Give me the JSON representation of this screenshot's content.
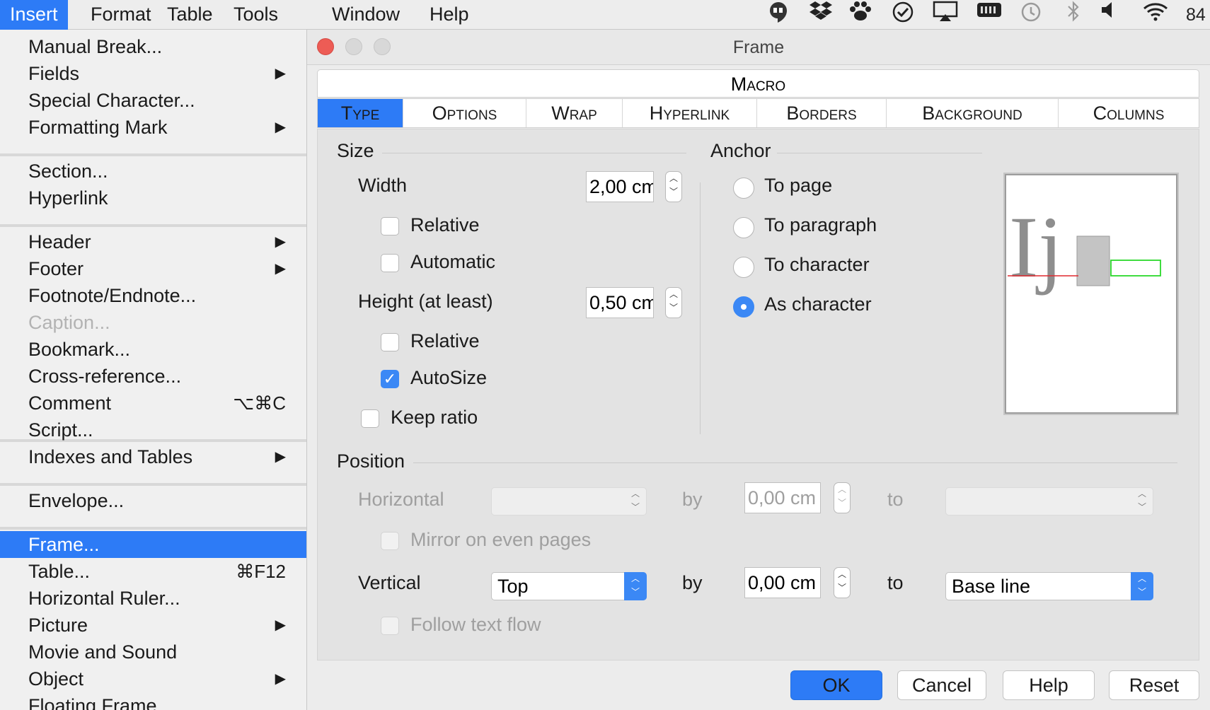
{
  "menubar": {
    "items": [
      "Insert",
      "Format",
      "Table",
      "Tools",
      "Window",
      "Help"
    ],
    "tray": [
      "hangouts-icon",
      "dropbox-icon",
      "paw-icon",
      "checkmark-circle-icon",
      "airplay-icon",
      "battery-meter-icon",
      "time-machine-icon",
      "bluetooth-icon",
      "volume-icon",
      "wifi-icon"
    ],
    "battery_text": "84"
  },
  "menu": {
    "items": [
      {
        "label": "Manual Break...",
        "arrow": false,
        "shortcut": "",
        "state": "normal"
      },
      {
        "label": "Fields",
        "arrow": true,
        "shortcut": "",
        "state": "normal"
      },
      {
        "label": "Special Character...",
        "arrow": false,
        "shortcut": "",
        "state": "normal"
      },
      {
        "label": "Formatting Mark",
        "arrow": true,
        "shortcut": "",
        "state": "normal"
      },
      {
        "label": "Section...",
        "arrow": false,
        "shortcut": "",
        "state": "normal"
      },
      {
        "label": "Hyperlink",
        "arrow": false,
        "shortcut": "",
        "state": "normal"
      },
      {
        "label": "Header",
        "arrow": true,
        "shortcut": "",
        "state": "normal"
      },
      {
        "label": "Footer",
        "arrow": true,
        "shortcut": "",
        "state": "normal"
      },
      {
        "label": "Footnote/Endnote...",
        "arrow": false,
        "shortcut": "",
        "state": "normal"
      },
      {
        "label": "Caption...",
        "arrow": false,
        "shortcut": "",
        "state": "disabled"
      },
      {
        "label": "Bookmark...",
        "arrow": false,
        "shortcut": "",
        "state": "normal"
      },
      {
        "label": "Cross-reference...",
        "arrow": false,
        "shortcut": "",
        "state": "normal"
      },
      {
        "label": "Comment",
        "arrow": false,
        "shortcut": "⌥⌘C",
        "state": "normal"
      },
      {
        "label": "Script...",
        "arrow": false,
        "shortcut": "",
        "state": "normal"
      },
      {
        "label": "Indexes and Tables",
        "arrow": true,
        "shortcut": "",
        "state": "normal"
      },
      {
        "label": "Envelope...",
        "arrow": false,
        "shortcut": "",
        "state": "normal"
      },
      {
        "label": "Frame...",
        "arrow": false,
        "shortcut": "",
        "state": "selected"
      },
      {
        "label": "Table...",
        "arrow": false,
        "shortcut": "⌘F12",
        "state": "normal"
      },
      {
        "label": "Horizontal Ruler...",
        "arrow": false,
        "shortcut": "",
        "state": "normal"
      },
      {
        "label": "Picture",
        "arrow": true,
        "shortcut": "",
        "state": "normal"
      },
      {
        "label": "Movie and Sound",
        "arrow": false,
        "shortcut": "",
        "state": "normal"
      },
      {
        "label": "Object",
        "arrow": true,
        "shortcut": "",
        "state": "normal"
      },
      {
        "label": "Floating Frame...",
        "arrow": false,
        "shortcut": "",
        "state": "normal"
      }
    ]
  },
  "dialog": {
    "title": "Frame",
    "top_tab": "Macro",
    "tabs": [
      "Type",
      "Options",
      "Wrap",
      "Hyperlink",
      "Borders",
      "Background",
      "Columns"
    ],
    "active_tab": "Type",
    "size": {
      "heading": "Size",
      "width_label": "Width",
      "width_value": "2,00 cm",
      "relative_label": "Relative",
      "automatic_label": "Automatic",
      "height_label": "Height (at least)",
      "height_value": "0,50 cm",
      "height_relative_label": "Relative",
      "autosize_label": "AutoSize",
      "keep_ratio_label": "Keep ratio"
    },
    "anchor": {
      "heading": "Anchor",
      "options": [
        "To page",
        "To paragraph",
        "To character",
        "As character"
      ],
      "selected": "As character"
    },
    "preview": {
      "glyphs": "Ij"
    },
    "position": {
      "heading": "Position",
      "horizontal_label": "Horizontal",
      "horizontal_by_label": "by",
      "horizontal_by_value": "0,00 cm",
      "horizontal_to_label": "to",
      "mirror_label": "Mirror on even pages",
      "vertical_label": "Vertical",
      "vertical_value": "Top",
      "vertical_by_label": "by",
      "vertical_by_value": "0,00 cm",
      "vertical_to_label": "to",
      "vertical_to_value": "Base line",
      "follow_label": "Follow text flow"
    },
    "buttons": {
      "ok": "OK",
      "cancel": "Cancel",
      "help": "Help",
      "reset": "Reset"
    }
  },
  "colors": {
    "accent": "#2d7bf6",
    "close": "#ed5c55",
    "anchor_baseline": "#e0292e",
    "anchor_frame": "#2bd82b"
  }
}
